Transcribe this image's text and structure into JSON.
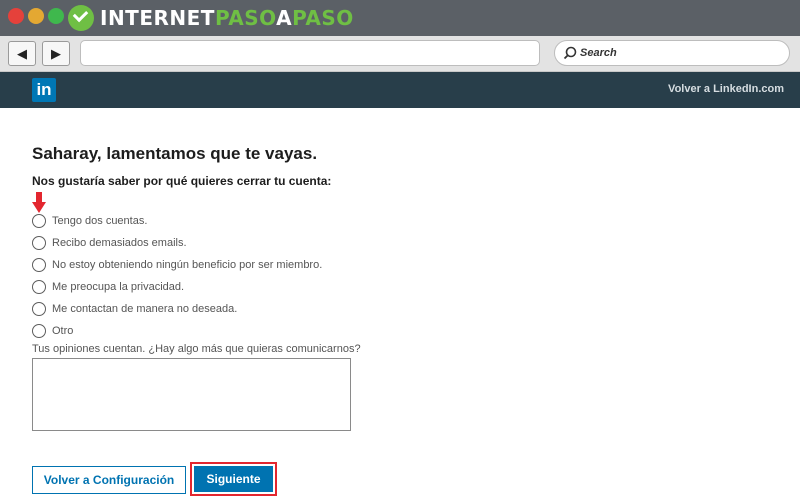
{
  "site": {
    "logo_text_white": "INTERNET",
    "logo_text_green_1": "PASO",
    "logo_text_mid": "A",
    "logo_text_green_2": "PASO",
    "logo_accent_color": "#6fbf44"
  },
  "browser": {
    "back_icon": "◀",
    "forward_icon": "▶",
    "url_value": "",
    "search_placeholder": "Search"
  },
  "linkedin": {
    "logo": "in",
    "back_link": "Volver a LinkedIn.com",
    "brand_color": "#0077b5"
  },
  "page": {
    "title": "Saharay, lamentamos que te vayas.",
    "question": "Nos gustaría saber por qué quieres cerrar tu cuenta:",
    "options": [
      {
        "label": "Tengo dos cuentas."
      },
      {
        "label": "Recibo demasiados emails."
      },
      {
        "label": "No estoy obteniendo ningún beneficio por ser miembro."
      },
      {
        "label": "Me preocupa la privacidad."
      },
      {
        "label": "Me contactan de manera no deseada."
      },
      {
        "label": "Otro"
      }
    ],
    "feedback_label": "Tus opiniones cuentan. ¿Hay algo más que quieras comunicarnos?",
    "feedback_value": "",
    "back_button": "Volver a Configuración",
    "next_button": "Siguiente",
    "highlight_color": "#e3262f"
  }
}
